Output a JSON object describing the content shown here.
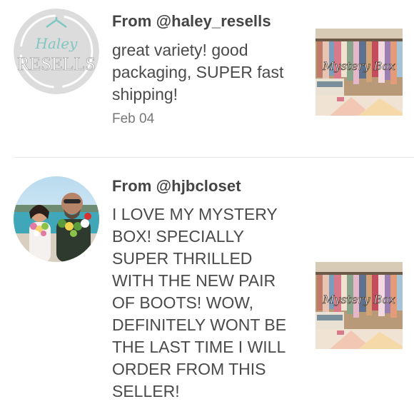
{
  "reviews": [
    {
      "from": "From @haley_resells",
      "comment": "great variety! good packaging, SUPER fast shipping!",
      "date": "Feb 04",
      "avatar_logo_text": [
        "Haley",
        "RESELLS"
      ],
      "thumbnail_text": "Mystery Box"
    },
    {
      "from": "From @hjbcloset",
      "comment": "I LOVE MY MYSTERY BOX! SPECIALLY SUPER THRILLED WITH THE NEW PAIR OF BOOTS! WOW, DEFINITELY WONT BE THE LAST TIME I WILL ORDER FROM THIS SELLER!",
      "thumbnail_text": "Mystery Box"
    }
  ],
  "colors": {
    "text": "#4a4a4a",
    "date": "#777777",
    "divider": "#e8e8e8",
    "logo_bg": "#d9d9d9",
    "logo_teal": "#7fc7c3"
  }
}
